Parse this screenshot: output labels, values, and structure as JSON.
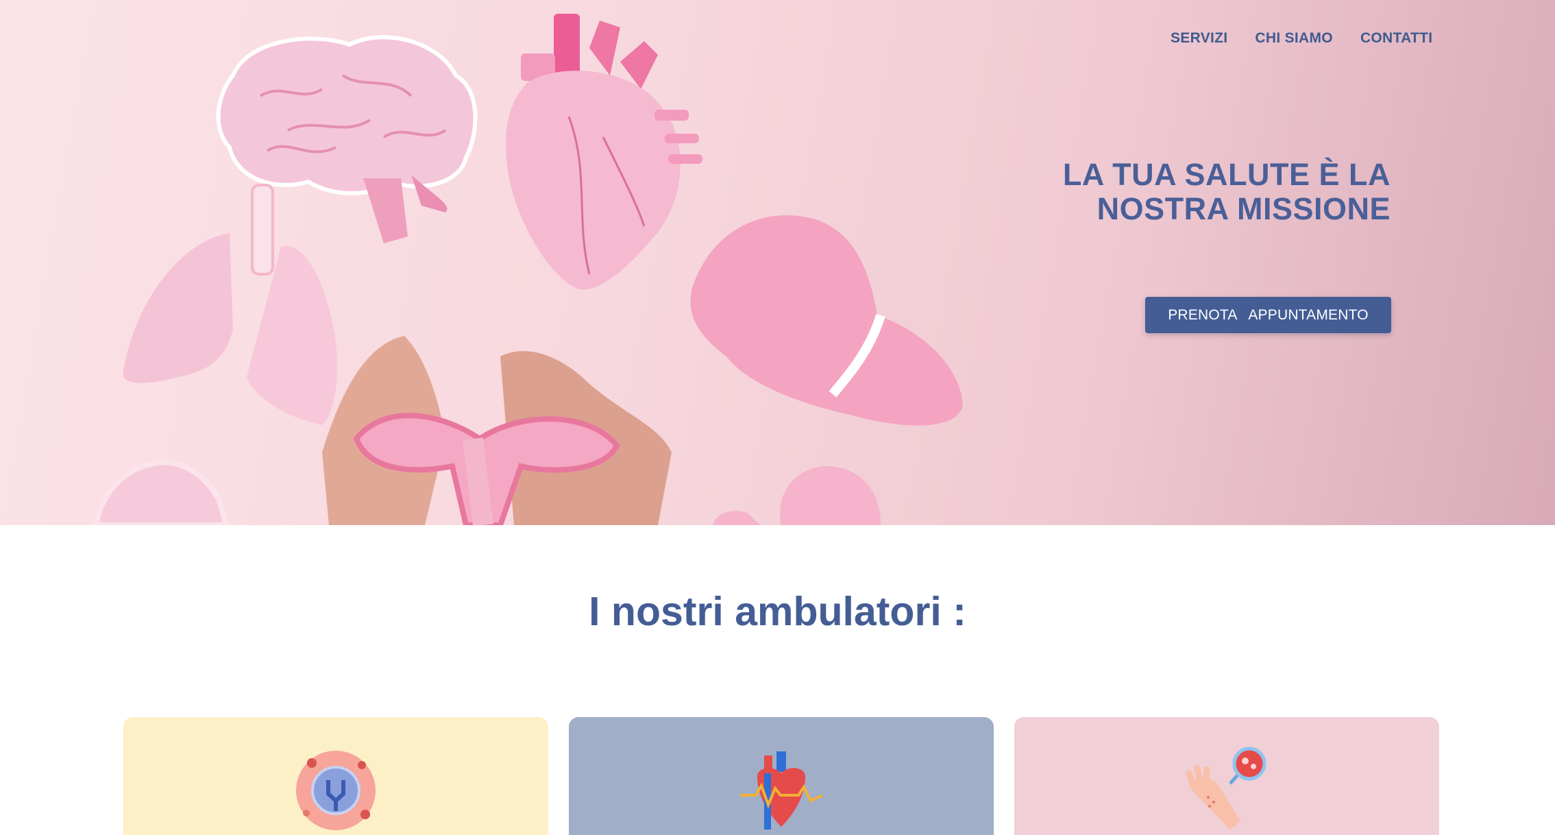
{
  "nav": {
    "items": [
      "SERVIZI",
      "CHI SIAMO",
      "CONTATTI"
    ]
  },
  "hero": {
    "headline": "LA TUA SALUTE È LA NOSTRA MISSIONE",
    "cta_label": "PRENOTA   APPUNTAMENTO"
  },
  "section": {
    "title": "I nostri ambulatori :"
  },
  "cards": [
    {
      "icon": "immunology-cell-icon",
      "color": "#fdf0c7"
    },
    {
      "icon": "heart-cardiology-icon",
      "color": "#a1aec8"
    },
    {
      "icon": "skin-dermatology-icon",
      "color": "#f0cfd6"
    }
  ],
  "colors": {
    "brand": "#445d95",
    "hero_bg": "#f7d8de"
  }
}
